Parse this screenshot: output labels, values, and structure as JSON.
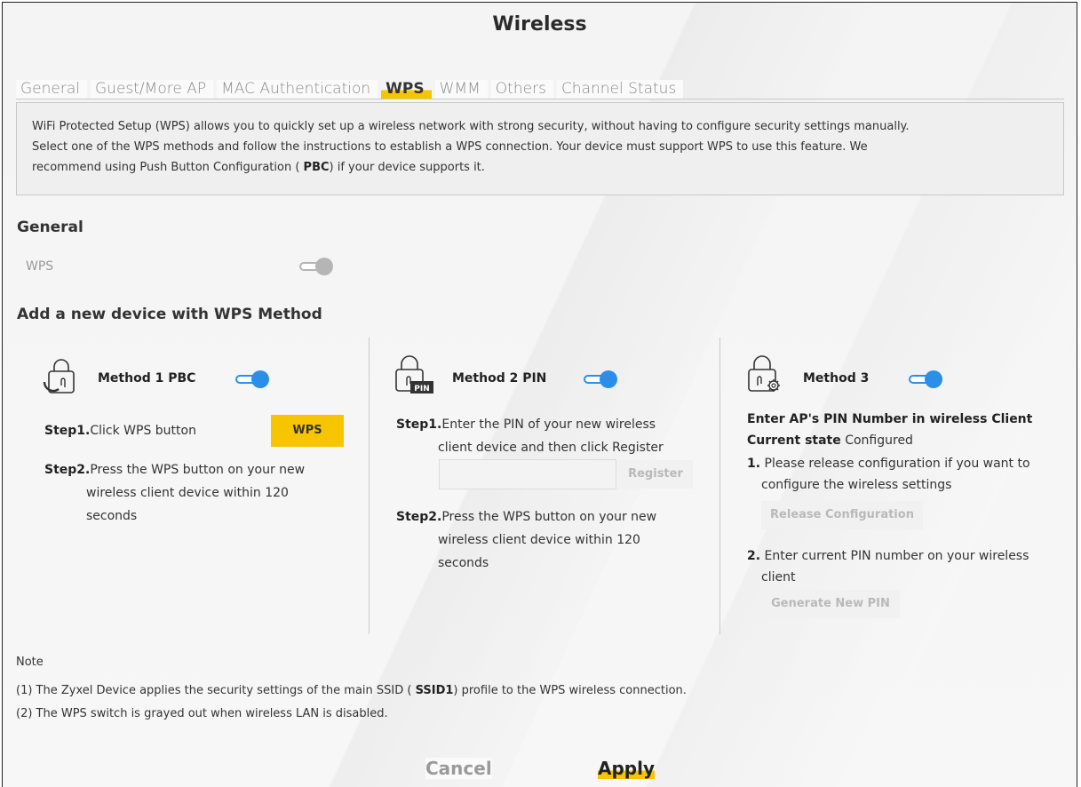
{
  "page": {
    "title": "Wireless"
  },
  "tabs": [
    {
      "label": "General"
    },
    {
      "label": "Guest/More AP"
    },
    {
      "label": "MAC Authentication"
    },
    {
      "label": "WPS"
    },
    {
      "label": "WMM"
    },
    {
      "label": "Others"
    },
    {
      "label": "Channel Status"
    }
  ],
  "info": {
    "line1": "WiFi Protected Setup (WPS) allows you to quickly set up a wireless network with strong security, without having to configure security settings manually.",
    "line2": "Select one of the WPS methods and follow the instructions to establish a WPS connection. Your device must support WPS to use this feature. We",
    "line3_pre": "recommend using Push Button Configuration (",
    "line3_bold": "PBC",
    "line3_post": ") if your device supports it."
  },
  "general": {
    "heading": "General",
    "wps_label": "WPS",
    "wps_enabled": true
  },
  "add_device": {
    "heading": "Add a new device with WPS Method"
  },
  "method1": {
    "title": "Method 1 PBC",
    "enabled": true,
    "step1_label": "Step1.",
    "step1_text": "Click WPS button",
    "wps_button": "WPS",
    "step2_label": "Step2.",
    "step2_line1": "Press the WPS button on your new",
    "step2_line2": "wireless client device within 120",
    "step2_line3": "seconds"
  },
  "method2": {
    "title": "Method 2 PIN",
    "enabled": true,
    "pin_badge": "PIN",
    "step1_label": "Step1.",
    "step1_line1": "Enter the PIN of your new wireless",
    "step1_line2": "client device and then click Register",
    "pin_value": "",
    "register_button": "Register",
    "step2_label": "Step2.",
    "step2_line1": "Press the WPS button on your new",
    "step2_line2": "wireless client device within 120",
    "step2_line3": "seconds"
  },
  "method3": {
    "title": "Method 3",
    "enabled": true,
    "heading": "Enter AP's PIN Number in wireless Client",
    "current_state_label": "Current state",
    "current_state_value": "Configured",
    "item1_num": "1.",
    "item1_line1": "Please release configuration if you want to",
    "item1_line2": "configure the wireless settings",
    "release_button": "Release Configuration",
    "item2_num": "2.",
    "item2_line1": "Enter current PIN number on your wireless",
    "item2_line2": "client",
    "generate_button": "Generate New PIN"
  },
  "notes": {
    "title": "Note",
    "note1_pre": "(1) The Zyxel Device applies the security settings of the main SSID (",
    "note1_bold": "SSID1",
    "note1_post": ") profile to the WPS wireless connection.",
    "note2": "(2) The WPS switch is grayed out when wireless LAN is disabled."
  },
  "footer": {
    "cancel": "Cancel",
    "apply": "Apply"
  },
  "colors": {
    "accent": "#f7c400",
    "toggle_on": "#2b8fe8",
    "toggle_disabled": "#b5b5b5"
  },
  "icons": {
    "method1": "lock-push-icon",
    "method2": "lock-pin-icon",
    "method3": "lock-gear-icon"
  }
}
